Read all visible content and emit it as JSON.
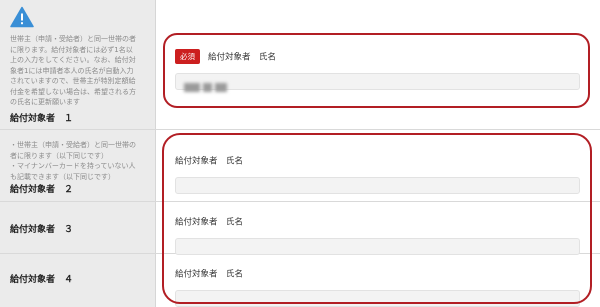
{
  "icon": "warning-triangle-icon",
  "colors": {
    "required_badge": "#cc1f1f",
    "highlight_ring": "#b21e24",
    "label_bg": "#ebebeb"
  },
  "rows": [
    {
      "note": "世帯主（申請・受給者）と同一世帯の者\nに限ります。給付対象者には必ず1名以\n上の入力をしてください。なお、給付対\n象者1には申請者本人の氏名が自動入力\nされていますので、世帯主が特別定額給\n付金を希望しない場合は、希望される方\nの氏名に更新願います",
      "label": "給付対象者　１",
      "required": "必須",
      "field_label": "給付対象者　氏名",
      "value": "▒▒ ▒"
    },
    {
      "note": "・世帯主（申請・受給者）と同一世帯の\n者に限ります（以下同じです）\n・マイナンバーカードを持っていない人\nも記載できます（以下同じです）",
      "label": "給付対象者　２",
      "field_label": "給付対象者　氏名",
      "value": ""
    },
    {
      "label": "給付対象者　３",
      "field_label": "給付対象者　氏名",
      "value": ""
    },
    {
      "label": "給付対象者　４",
      "field_label": "給付対象者　氏名",
      "value": ""
    }
  ]
}
